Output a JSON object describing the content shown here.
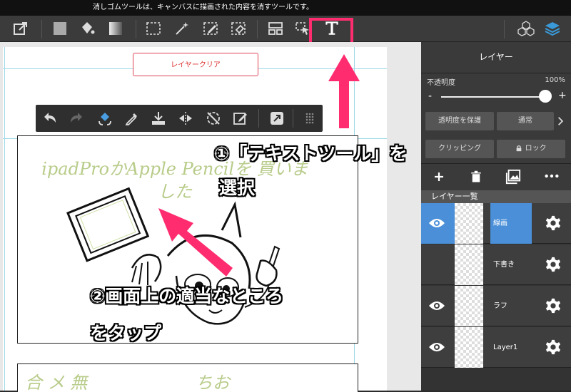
{
  "hint_text": "消しゴムツールは、キャンバスに描画された内容を消すツールです。",
  "toolbar": {
    "icons": [
      "export-icon",
      "fill-color-icon",
      "bucket-icon",
      "gradient-icon",
      "marquee-select-icon",
      "magic-wand-icon",
      "select-pen-icon",
      "select-eraser-icon",
      "layout-icon",
      "move-transform-icon",
      "text-tool-icon",
      "materials-icon",
      "layers-icon"
    ]
  },
  "canvas": {
    "clear_layer_button": "レイヤークリア",
    "floating_toolbar_icons": [
      "undo-icon",
      "redo-icon",
      "transform-icon",
      "eyedropper-icon",
      "save-icon",
      "flip-icon",
      "rotate-reset-icon",
      "edit-icon",
      "external-icon",
      "grid-handle-icon"
    ],
    "sketch_text": "ipadProかApple Pencilを 買いました",
    "bottom_sketch_text": "合 メ 無　　　　　　 ちお"
  },
  "layer_panel": {
    "title": "レイヤー",
    "opacity_label": "不透明度",
    "opacity_value": "100%",
    "opacity_level": 1.0,
    "minus_label": "-",
    "plus_label": "+",
    "protect_alpha": "透明度を保護",
    "blend_mode": "通常",
    "clipping": "クリッピング",
    "lock": "ロック",
    "layer_list_header": "レイヤー一覧",
    "layers": [
      {
        "name": "線画",
        "visible": true,
        "selected": true
      },
      {
        "name": "下書き",
        "visible": false,
        "selected": false
      },
      {
        "name": "ラフ",
        "visible": true,
        "selected": false
      },
      {
        "name": "Layer1",
        "visible": true,
        "selected": false
      }
    ]
  },
  "annotations": {
    "step1_line1": "①「テキストツール」を",
    "step1_line2": "選択",
    "step2_line1": "②画面上の適当なところ",
    "step2_line2": "をタップ"
  },
  "colors": {
    "highlight": "#ff2d6f",
    "accent_blue": "#4a8fd8",
    "sketch_green": "#b8cc8a"
  }
}
